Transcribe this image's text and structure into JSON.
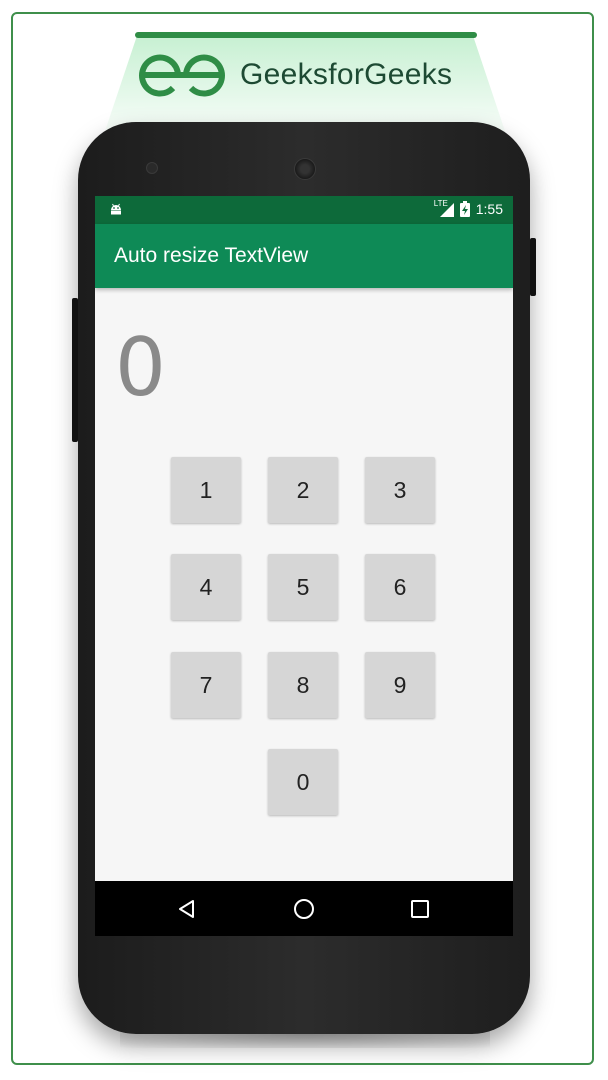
{
  "brand": {
    "name": "GeeksforGeeks",
    "accent": "#2f8d46"
  },
  "status_bar": {
    "network": "LTE",
    "time": "1:55",
    "color": "#0d6a3a"
  },
  "app_bar": {
    "title": "Auto resize TextView",
    "color": "#0e8a56"
  },
  "display": {
    "value": "0"
  },
  "keypad": {
    "keys": [
      "1",
      "2",
      "3",
      "4",
      "5",
      "6",
      "7",
      "8",
      "9",
      "0"
    ],
    "key_color": "#d6d6d6"
  },
  "nav_bar": {
    "icons": [
      "back-icon",
      "home-icon",
      "recents-icon"
    ]
  }
}
